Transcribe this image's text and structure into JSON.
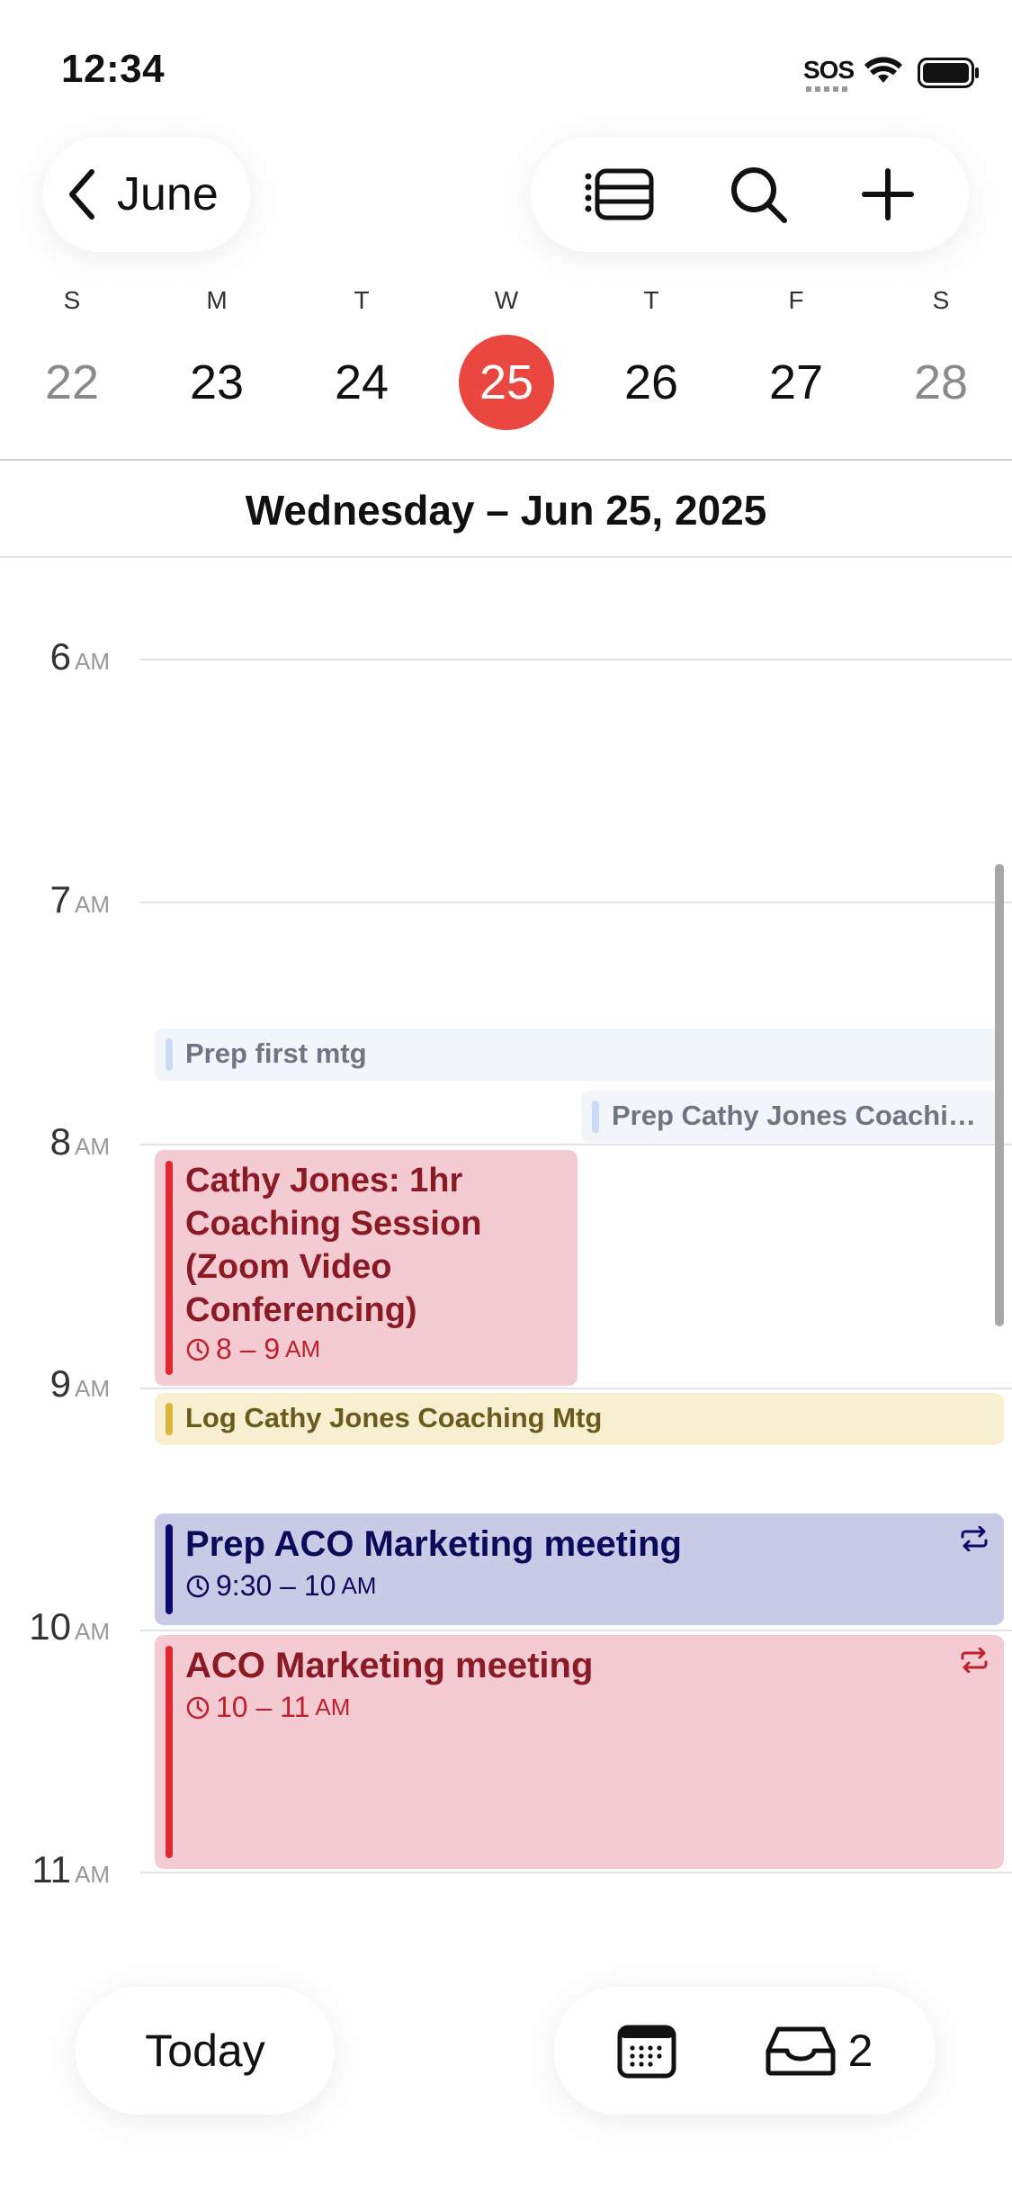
{
  "status_bar": {
    "time": "12:34",
    "sos": "SOS"
  },
  "header": {
    "back_label": "June"
  },
  "week": {
    "weekdays": [
      "S",
      "M",
      "T",
      "W",
      "T",
      "F",
      "S"
    ],
    "dates": [
      "22",
      "23",
      "24",
      "25",
      "26",
      "27",
      "28"
    ],
    "selected_index": 3
  },
  "day_title": "Wednesday – Jun 25, 2025",
  "hours": [
    {
      "num": "6",
      "ampm": "AM"
    },
    {
      "num": "7",
      "ampm": "AM"
    },
    {
      "num": "8",
      "ampm": "AM"
    },
    {
      "num": "9",
      "ampm": "AM"
    },
    {
      "num": "10",
      "ampm": "AM"
    },
    {
      "num": "11",
      "ampm": "AM"
    }
  ],
  "events": {
    "prep_first": {
      "title": "Prep first mtg"
    },
    "prep_cathy": {
      "title": "Prep Cathy Jones  Coaching Mtg"
    },
    "cathy": {
      "title": "Cathy Jones: 1hr Coaching Session (Zoom Video Conferencing)",
      "time": "8 – 9",
      "ampm": "AM"
    },
    "log": {
      "title": "Log Cathy Jones  Coaching Mtg"
    },
    "prep_aco": {
      "title": "Prep ACO Marketing meeting",
      "time": "9:30 – 10",
      "ampm": "AM"
    },
    "aco": {
      "title": "ACO Marketing meeting",
      "time": "10 – 11",
      "ampm": "AM"
    }
  },
  "bottom": {
    "today_label": "Today",
    "inbox_count": "2"
  },
  "colors": {
    "today_red": "#e9473f",
    "event_red": "#e0262f",
    "event_navy": "#0b0b6e",
    "event_yellow": "#d9b73a"
  }
}
